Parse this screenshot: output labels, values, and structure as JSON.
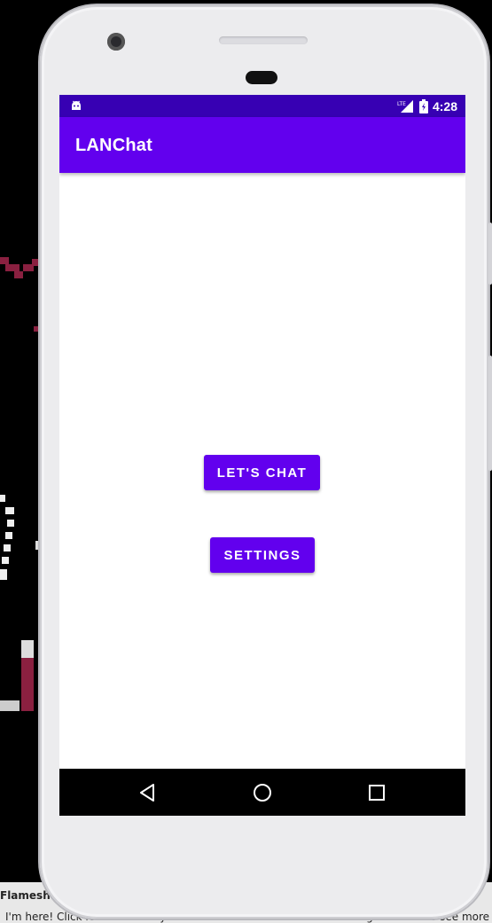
{
  "desktop": {
    "notice_title": "Flamesho",
    "notice_text": "I'm here! Click icon in the tray to take a screenshot or click with a right button to see more"
  },
  "status_bar": {
    "network_label": "LTE",
    "time": "4:28",
    "notification_icon": "android-icon",
    "signal_icon": "signal-icon",
    "battery_icon": "battery-charging-icon"
  },
  "app_bar": {
    "title": "LANChat"
  },
  "main": {
    "chat_button_label": "LET'S CHAT",
    "settings_button_label": "SETTINGS"
  },
  "nav_bar": {
    "back_icon": "back-icon",
    "home_icon": "home-icon",
    "recents_icon": "recents-icon"
  },
  "colors": {
    "primary": "#6200ee",
    "primary_dark": "#3700b3",
    "on_primary": "#ffffff",
    "background": "#ffffff",
    "nav_bar": "#000000"
  }
}
